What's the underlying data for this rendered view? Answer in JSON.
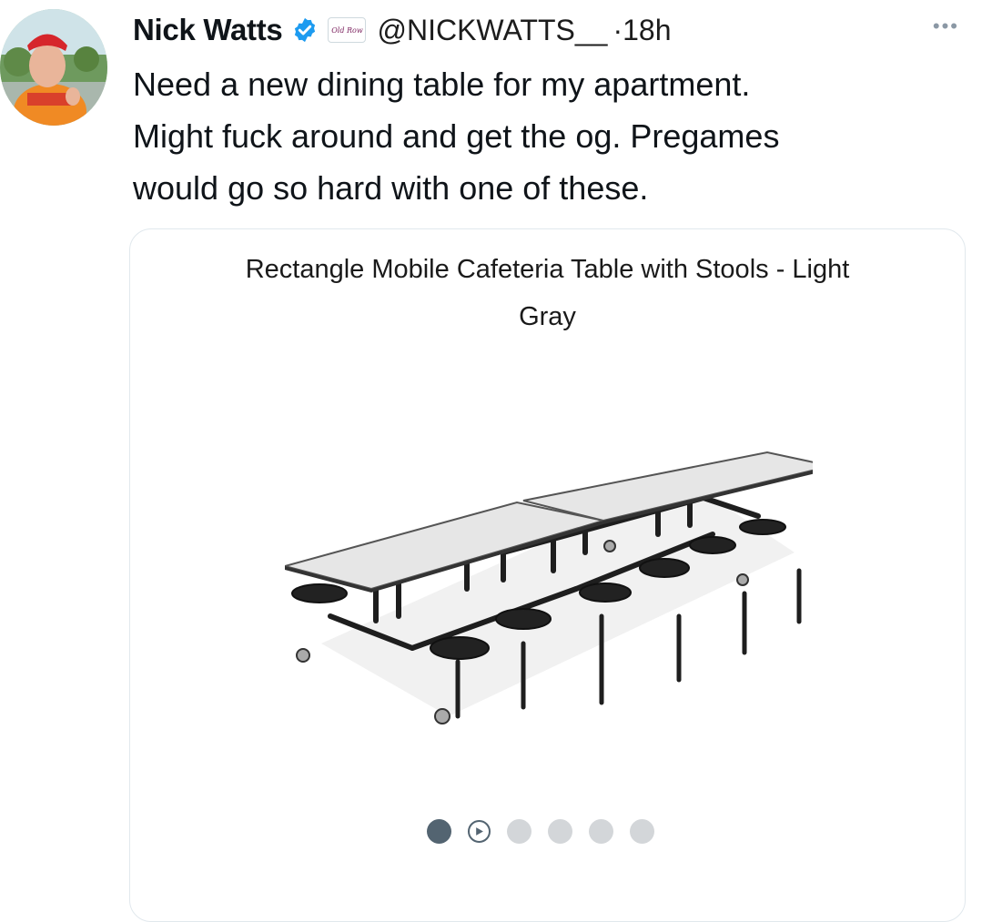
{
  "tweet": {
    "author_name": "Nick Watts",
    "handle": "@NICKWATTS__",
    "separator": "·",
    "time": "18h",
    "affiliate_badge": "Old Row",
    "more": "•••",
    "text_lines": [
      "Need a new dining table for my apartment.",
      "Might fuck around and get the og. Pregames",
      "would go so hard with one of these."
    ]
  },
  "card": {
    "title_lines": [
      "Rectangle Mobile Cafeteria Table with Stools - Light",
      "Gray"
    ],
    "pager": {
      "total": 6,
      "active_index": 0,
      "video_index": 1
    }
  },
  "colors": {
    "verified": "#1d9bf0",
    "pager_active": "#536471",
    "pager_inactive": "#d3d6d9",
    "table_top": "#e6e6e6"
  },
  "icons": [
    "verified-badge-icon",
    "more-options-icon",
    "play-icon"
  ]
}
